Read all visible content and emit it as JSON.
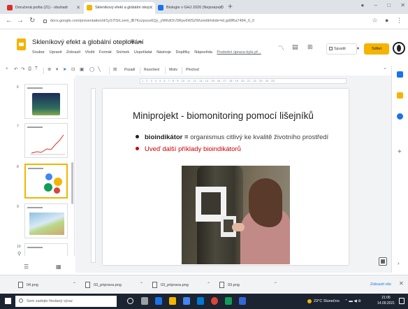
{
  "browser": {
    "tabs": [
      {
        "label": "Doručená pošta (21) - obuhadr",
        "favicon_color": "#d93025"
      },
      {
        "label": "Skleníkový efekt a globální otep",
        "favicon_color": "#f4b400"
      },
      {
        "label": "Biologie v GHJ 2020 (Nejsnáze D",
        "favicon_color": "#1a73e8"
      }
    ],
    "new_tab_glyph": "+",
    "url": "docs.google.com/presentation/d/1yS7ISrLzem_lB7Kzzpsuv6Qy_yWKdOl:/0Rpv6WSZWu/edit#slide=id.gd9f6a7484_0_0"
  },
  "docs": {
    "title": "Skleníkový efekt a globální oteplování",
    "menu": [
      "Soubor",
      "Upravit",
      "Zobrazit",
      "Vložit",
      "Formát",
      "Snímek",
      "Uspořádat",
      "Nástroje",
      "Doplňky",
      "Nápověda"
    ],
    "last_edit": "Poslední úprava byla př...",
    "present_label": "Spustit",
    "share_label": "Sdílet"
  },
  "toolbar": {
    "background_label": "Pozadí",
    "layout_label": "Rozvržení",
    "theme_label": "Motiv",
    "transition_label": "Přechod"
  },
  "ruler": {
    "ticks": "1 · 2 · 3 · 4 · 5 · 6 · 7 · 8 · 9 · 10 · 11 · 12 · 13 · 14 · 15 · 16 · 17 · 18 · 19 · 20 · 21 · 22 · 23 · 24 · 25"
  },
  "filmstrip": {
    "slide_numbers": [
      "6",
      "7",
      "8",
      "9",
      "10"
    ]
  },
  "slide": {
    "title": "Miniprojekt - biomonitoring pomocí lišejníků",
    "bullet1_bold": "bioindikátor =",
    "bullet1_rest": " organismus citlivý ke kvalitě životního prostředí",
    "bullet2": "Uveď další příklady bioindikátorů"
  },
  "downloads": {
    "items": [
      "04.png",
      "03_priprava.png",
      "03_priprava.png",
      "03.png"
    ],
    "show_all": "Zobrazit vše"
  },
  "taskbar": {
    "search_placeholder": "Sem zadejte hledaný výraz",
    "weather": "23°C Slunečno",
    "time": "21:06",
    "date": "14.09.2021"
  },
  "colors": {
    "accent": "#f4b400",
    "bullet_red": "#cc0000",
    "taskbar": "#1c2331"
  }
}
